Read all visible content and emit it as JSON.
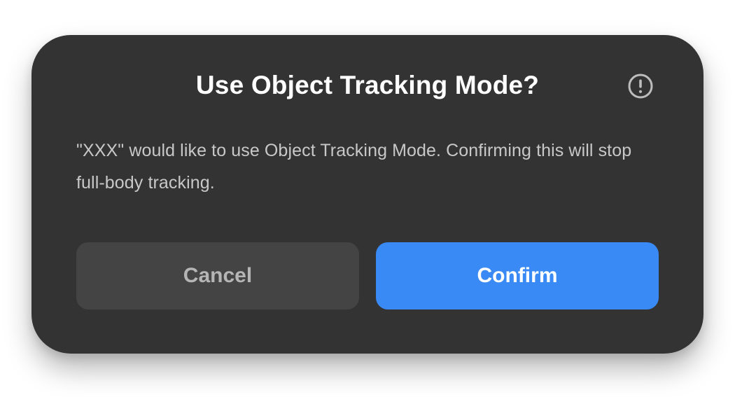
{
  "dialog": {
    "title": "Use Object Tracking Mode?",
    "alert_icon": "exclamation-circle-icon",
    "message": "\"XXX\" would like to use Object Tracking Mode. Confirming this will stop full-body tracking.",
    "buttons": {
      "cancel_label": "Cancel",
      "confirm_label": "Confirm"
    }
  },
  "colors": {
    "dialog_background": "#333333",
    "cancel_background": "#444444",
    "confirm_background": "#3a8af6",
    "title_text": "#ffffff",
    "message_text": "#c8c8c8"
  }
}
